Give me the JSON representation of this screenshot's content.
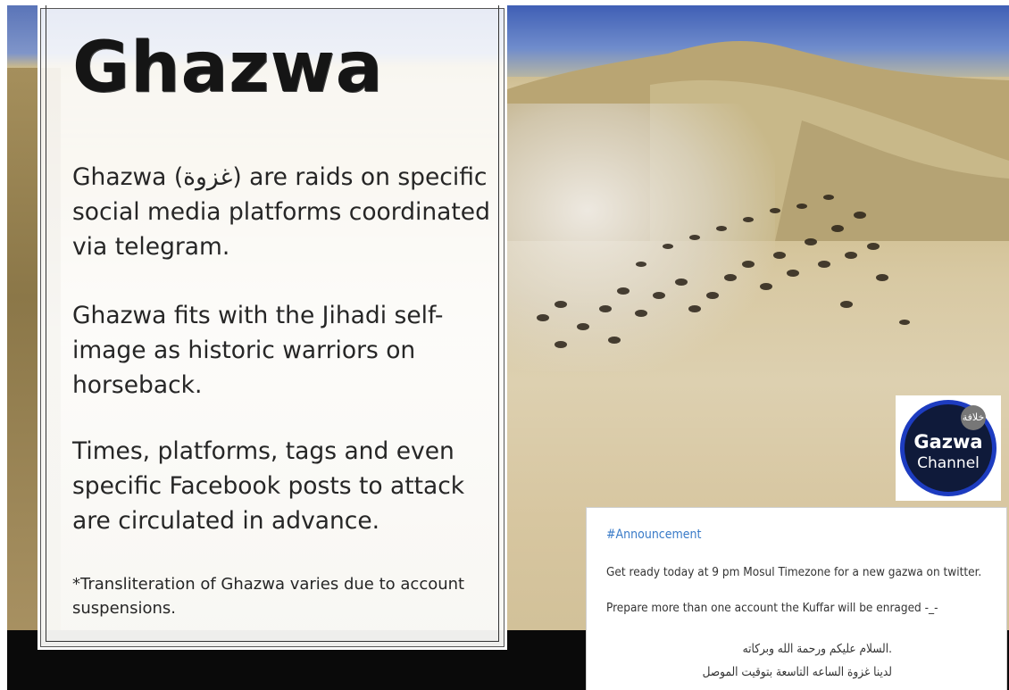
{
  "slide": {
    "title": "Ghazwa",
    "paragraphs": [
      "Ghazwa (غزوة) are raids on specific social media platforms coordinated via telegram.",
      "Ghazwa fits with the Jihadi self-image as historic warriors on horseback.",
      "Times, platforms, tags and even specific Facebook posts to attack are circulated in advance."
    ],
    "note": "*Transliteration of Ghazwa varies due to account suspensions."
  },
  "logo": {
    "mark": "خلافة",
    "line1": "Gazwa",
    "line2": "Channel"
  },
  "announcement": {
    "tag": "#Announcement",
    "lines": [
      "Get ready today at 9 pm Mosul Timezone for a new gazwa on twitter.",
      "Prepare more than one account the Kuffar will be enraged -_-"
    ],
    "arabic_lines": [
      ".السلام عليكم ورحمة الله وبركاته",
      "لدينا غزوة الساعه التاسعة بتوقيت الموصل"
    ]
  },
  "colors": {
    "accent_tag": "#3a7bc8",
    "logo_ring": "#1d3cc0",
    "logo_fill": "#0f1a3a"
  }
}
